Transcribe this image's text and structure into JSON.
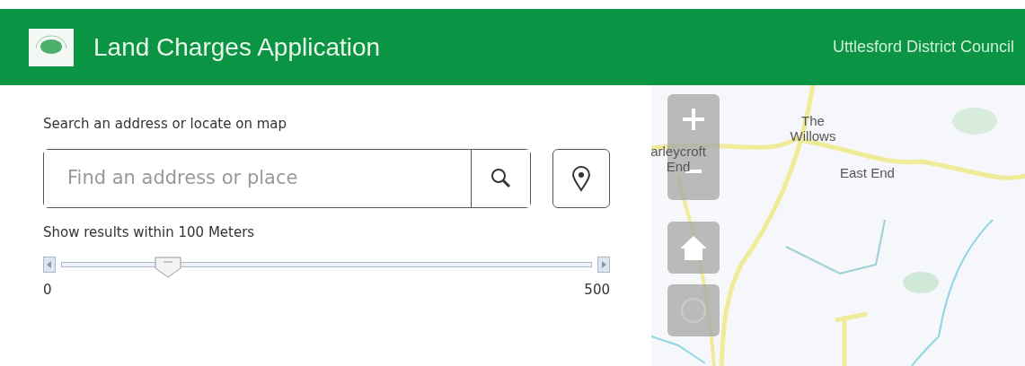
{
  "header": {
    "title": "Land Charges Application",
    "organization": "Uttlesford District Council"
  },
  "search_panel": {
    "prompt": "Search an address or locate on map",
    "search": {
      "placeholder": "Find an address or place"
    },
    "distance": {
      "label": "Show results within 100 Meters",
      "level": 0.2,
      "min": "0",
      "max": "500"
    }
  },
  "map": {
    "labels": [
      {
        "text": "The Willows"
      },
      {
        "text": "East End"
      },
      {
        "text": "arleycroft End"
      }
    ]
  }
}
